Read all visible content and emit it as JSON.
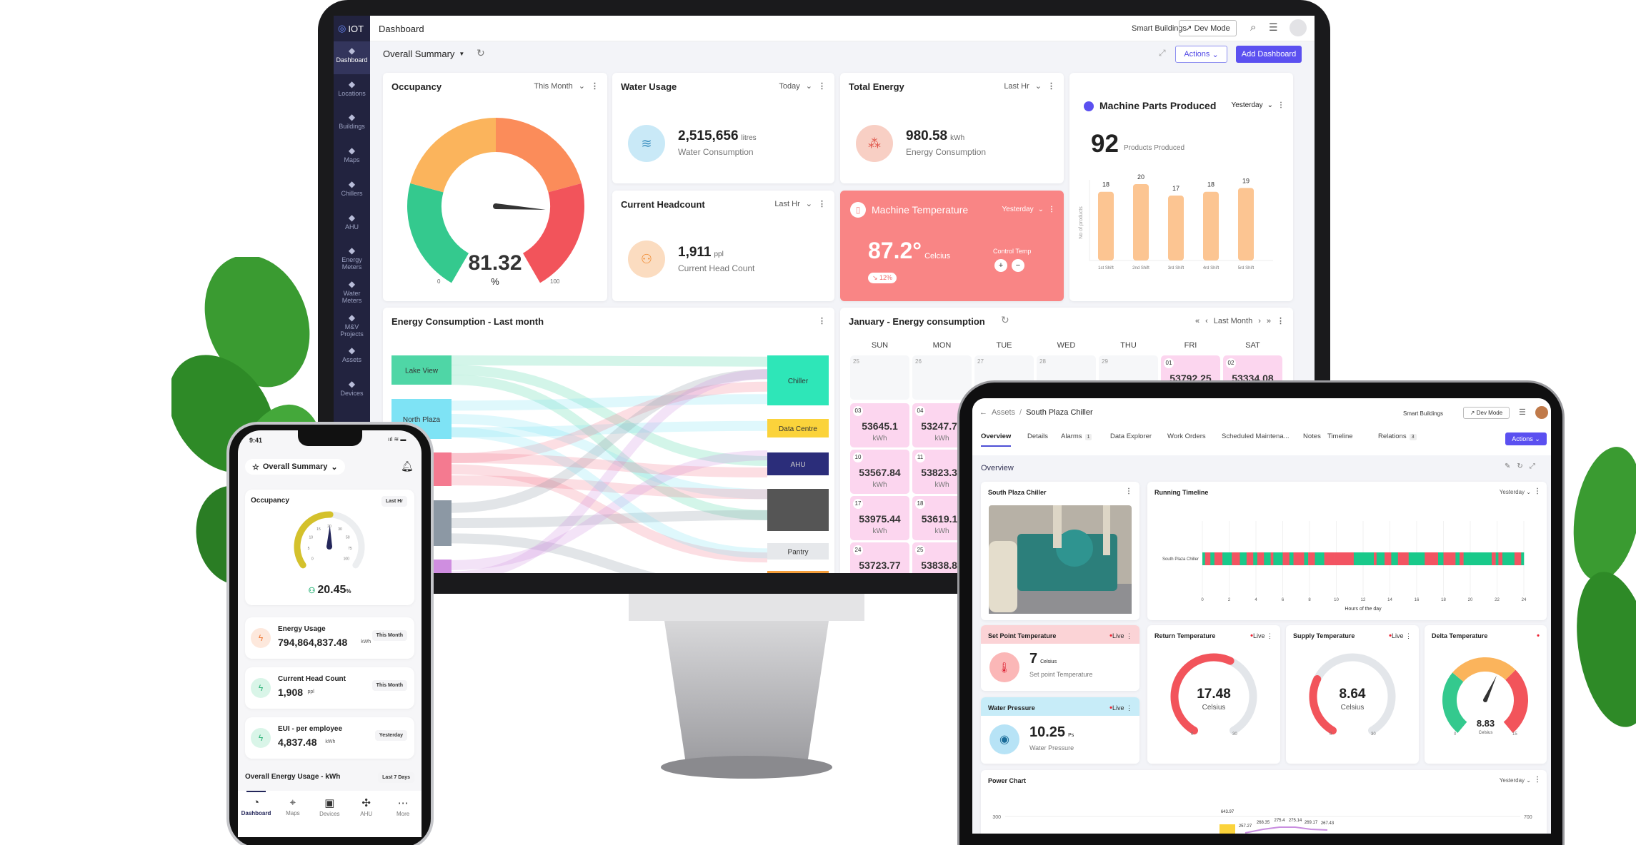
{
  "colors": {
    "accent": "#4f46e5",
    "sidebar": "#22233f",
    "green": "#34c98e",
    "red": "#f2545b",
    "orange": "#fb8c5a",
    "yellow": "#fbb45c",
    "pink": "#fcd6ef",
    "salmon": "#f98585"
  },
  "desktop": {
    "logo": "IOT",
    "header": {
      "title": "Dashboard",
      "org": "Smart Buildings",
      "dev_mode": "Dev Mode"
    },
    "toolbar": {
      "summary": "Overall Summary",
      "actions": "Actions",
      "add_dashboard": "Add Dashboard"
    },
    "sidebar": [
      {
        "label": "Dashboard",
        "icon": "dashboard-icon",
        "active": true
      },
      {
        "label": "Locations",
        "icon": "location-icon"
      },
      {
        "label": "Buildings",
        "icon": "building-icon"
      },
      {
        "label": "Maps",
        "icon": "map-pin-icon"
      },
      {
        "label": "Chillers",
        "icon": "chiller-icon"
      },
      {
        "label": "AHU",
        "icon": "ahu-icon"
      },
      {
        "label": "Energy Meters",
        "icon": "energy-meter-icon"
      },
      {
        "label": "Water Meters",
        "icon": "water-meter-icon"
      },
      {
        "label": "M&V Projects",
        "icon": "project-icon"
      },
      {
        "label": "Assets",
        "icon": "asset-icon"
      },
      {
        "label": "Devices",
        "icon": "device-icon"
      }
    ],
    "occupancy": {
      "title": "Occupancy",
      "period": "This Month",
      "value": 81.32,
      "value_text": "81.32",
      "unit": "%",
      "min": "0",
      "max": "100"
    },
    "water": {
      "title": "Water Usage",
      "period": "Today",
      "value": "2,515,656",
      "unit": "litres",
      "label": "Water Consumption"
    },
    "energy": {
      "title": "Total Energy",
      "period": "Last Hr",
      "value": "980.58",
      "unit": "kWh",
      "label": "Energy Consumption"
    },
    "headcount": {
      "title": "Current Headcount",
      "period": "Last Hr",
      "value": "1,911",
      "unit": "ppl",
      "label": "Current Head Count"
    },
    "machine_temp": {
      "title": "Machine Temperature",
      "period": "Yesterday",
      "value": "87.2°",
      "unit": "Celcius",
      "control": "Control Temp",
      "plus": "+",
      "minus": "−",
      "badge": "↘ 12%"
    },
    "parts": {
      "title": "Machine Parts Produced",
      "period": "Yesterday",
      "value": "92",
      "label": "Products Produced"
    },
    "sankey": {
      "title": "Energy Consumption - Last month",
      "sources": [
        {
          "label": "Lake View",
          "color": "#4fd6a6"
        },
        {
          "label": "North Plaza",
          "color": "#7ee3f5"
        },
        {
          "label": "",
          "color": "#f47a90"
        },
        {
          "label": "",
          "color": "#8c98a4"
        },
        {
          "label": "",
          "color": "#cf8ee0"
        }
      ],
      "targets": [
        {
          "label": "Chiller",
          "color": "#2ee6b8"
        },
        {
          "label": "Data Centre",
          "color": "#fbd33b"
        },
        {
          "label": "AHU",
          "color": "#2b2d7a"
        },
        {
          "label": "",
          "color": "#555"
        },
        {
          "label": "Pantry",
          "color": "#e6e8eb"
        },
        {
          "label": "",
          "color": "#f59e3b"
        }
      ]
    },
    "calendar": {
      "title": "January - Energy consumption",
      "nav": "Last Month",
      "days": [
        "SUN",
        "MON",
        "TUE",
        "WED",
        "THU",
        "FRI",
        "SAT"
      ],
      "cells": [
        {
          "row": 0,
          "col": 0,
          "date": "25"
        },
        {
          "row": 0,
          "col": 1,
          "date": "26"
        },
        {
          "row": 0,
          "col": 2,
          "date": "27"
        },
        {
          "row": 0,
          "col": 3,
          "date": "28"
        },
        {
          "row": 0,
          "col": 4,
          "date": "29"
        },
        {
          "row": 0,
          "col": 5,
          "date": "01",
          "value": "53792.25",
          "unit": "kWh"
        },
        {
          "row": 0,
          "col": 6,
          "date": "02",
          "value": "53334.08",
          "unit": "kWh"
        },
        {
          "row": 1,
          "col": 0,
          "date": "03",
          "value": "53645.1",
          "unit": "kWh"
        },
        {
          "row": 1,
          "col": 1,
          "date": "04",
          "value": "53247.76",
          "unit": "kWh"
        },
        {
          "row": 2,
          "col": 0,
          "date": "10",
          "value": "53567.84",
          "unit": "kWh"
        },
        {
          "row": 2,
          "col": 1,
          "date": "11",
          "value": "53823.33",
          "unit": "kWh"
        },
        {
          "row": 3,
          "col": 0,
          "date": "17",
          "value": "53975.44",
          "unit": "kWh"
        },
        {
          "row": 3,
          "col": 1,
          "date": "18",
          "value": "53619.11",
          "unit": "kWh"
        },
        {
          "row": 4,
          "col": 0,
          "date": "24",
          "value": "53723.77",
          "unit": "kWh"
        },
        {
          "row": 4,
          "col": 1,
          "date": "25",
          "value": "53838.82",
          "unit": "kWh"
        }
      ]
    }
  },
  "chart_data": [
    {
      "type": "bar",
      "title": "Machine Parts Produced",
      "ylabel": "No of products",
      "categories": [
        "1st Shift",
        "2nd Shift",
        "3rd Shift",
        "4rd Shift",
        "5rd Shift"
      ],
      "values": [
        18,
        20,
        17,
        18,
        19
      ],
      "ylim": [
        0,
        20
      ],
      "grid": false
    },
    {
      "type": "timeline",
      "title": "Running Timeline",
      "period": "Yesterday",
      "row_label": "South Plaza Chiller",
      "xlabel": "Hours of the day",
      "xticks": [
        "0",
        "2",
        "4",
        "6",
        "8",
        "10",
        "12",
        "14",
        "16",
        "18",
        "20",
        "22",
        "24"
      ],
      "xlim": [
        0,
        24
      ],
      "segments": [
        [
          0,
          0.2,
          "on"
        ],
        [
          0.2,
          0.6,
          "off"
        ],
        [
          0.6,
          0.9,
          "on"
        ],
        [
          0.9,
          1.5,
          "off"
        ],
        [
          1.5,
          2.2,
          "on"
        ],
        [
          2.2,
          2.8,
          "off"
        ],
        [
          2.8,
          3.3,
          "on"
        ],
        [
          3.3,
          3.8,
          "off"
        ],
        [
          3.8,
          4.1,
          "on"
        ],
        [
          4.1,
          4.6,
          "off"
        ],
        [
          4.6,
          5.1,
          "on"
        ],
        [
          5.1,
          5.3,
          "off"
        ],
        [
          5.3,
          6.0,
          "on"
        ],
        [
          6.0,
          6.5,
          "off"
        ],
        [
          6.5,
          6.8,
          "on"
        ],
        [
          6.8,
          7.6,
          "off"
        ],
        [
          7.6,
          7.9,
          "on"
        ],
        [
          7.9,
          8.4,
          "off"
        ],
        [
          8.4,
          9.1,
          "on"
        ],
        [
          9.1,
          9.9,
          "off"
        ],
        [
          9.9,
          11.3,
          "off"
        ],
        [
          11.3,
          12.8,
          "on"
        ],
        [
          12.8,
          13.0,
          "off"
        ],
        [
          13.0,
          13.6,
          "on"
        ],
        [
          13.6,
          14.1,
          "off"
        ],
        [
          14.1,
          14.6,
          "on"
        ],
        [
          14.6,
          15.4,
          "off"
        ],
        [
          15.4,
          16.6,
          "on"
        ],
        [
          16.6,
          17.6,
          "off"
        ],
        [
          17.6,
          18.0,
          "on"
        ],
        [
          18.0,
          18.9,
          "off"
        ],
        [
          18.9,
          19.2,
          "on"
        ],
        [
          19.2,
          19.5,
          "off"
        ],
        [
          19.5,
          20.0,
          "on"
        ],
        [
          20.0,
          21.6,
          "on"
        ],
        [
          21.6,
          21.9,
          "off"
        ],
        [
          21.9,
          22.1,
          "on"
        ],
        [
          22.1,
          22.4,
          "off"
        ],
        [
          22.4,
          23.3,
          "on"
        ],
        [
          23.3,
          23.8,
          "off"
        ],
        [
          23.8,
          24,
          "on"
        ]
      ],
      "colors": {
        "on": "#19c98a",
        "off": "#f25462"
      }
    },
    {
      "type": "line",
      "title": "Power Chart",
      "period": "Yesterday",
      "y_left_max_label": "300",
      "y_right_max_label": "700",
      "labels": [
        "643.97",
        "257.27",
        "268.35",
        "275.4",
        "275.14",
        "269.17",
        "267.43"
      ]
    }
  ],
  "tablet": {
    "breadcrumb": {
      "parent": "Assets",
      "separator": "/",
      "current": "South Plaza Chiller"
    },
    "org": "Smart Buildings",
    "dev_mode": "Dev Mode",
    "actions": "Actions",
    "tabs": [
      {
        "label": "Overview",
        "active": true
      },
      {
        "label": "Details"
      },
      {
        "label": "Alarms",
        "badge": "1"
      },
      {
        "label": "Data Explorer"
      },
      {
        "label": "Work Orders"
      },
      {
        "label": "Scheduled Maintena..."
      },
      {
        "label": "Notes"
      },
      {
        "label": "Timeline"
      },
      {
        "label": "Relations",
        "badge": "3"
      }
    ],
    "section": "Overview",
    "asset_card": {
      "title": "South Plaza Chiller"
    },
    "live": "Live",
    "setpoint": {
      "title": "Set Point Temperature",
      "value": "7",
      "unit": "Celsius",
      "label": "Set point Temperature"
    },
    "pressure": {
      "title": "Water Pressure",
      "value": "10.25",
      "unit": "Ps",
      "label": "Water Pressure"
    },
    "return_temp": {
      "title": "Return Temperature",
      "value": 17.48,
      "value_text": "17.48",
      "unit": "Celsius",
      "min": "0",
      "max": "30",
      "max_value": 30
    },
    "supply_temp": {
      "title": "Supply Temperature",
      "value": 8.64,
      "value_text": "8.64",
      "unit": "Celsius",
      "min": "0",
      "max": "30",
      "max_value": 30
    },
    "delta_temp": {
      "title": "Delta Temperature",
      "value": 8.83,
      "value_text": "8.83",
      "unit": "Celsius",
      "min": "0",
      "max": "15",
      "max_value": 15
    }
  },
  "phone": {
    "time": "9:41",
    "summary": "Overall Summary",
    "occupancy": {
      "title": "Occupancy",
      "period": "Last Hr",
      "value": 20.45,
      "value_text": "20.45",
      "unit": "%",
      "ticks": [
        "0",
        "5",
        "10",
        "15",
        "20",
        "30",
        "50",
        "75",
        "100"
      ]
    },
    "cards": [
      {
        "title": "Energy Usage",
        "value": "794,864,837.48",
        "unit": "kWh",
        "period": "This Month",
        "icon": "lightning-icon",
        "bg": "#fde8dc",
        "fg": "#f07a36"
      },
      {
        "title": "Current Head Count",
        "value": "1,908",
        "unit": "ppl",
        "period": "This Month",
        "icon": "people-icon",
        "bg": "#d9f5e8",
        "fg": "#2fb57a"
      },
      {
        "title": "EUI - per employee",
        "value": "4,837.48",
        "unit": "kWh",
        "period": "Yesterday",
        "icon": "lightning-icon",
        "bg": "#d9f5e8",
        "fg": "#2fb57a"
      }
    ],
    "overall": {
      "title": "Overall Energy Usage - kWh",
      "period": "Last 7 Days"
    },
    "nav": [
      {
        "label": "Dashboard",
        "icon": "dashboard-icon",
        "active": true
      },
      {
        "label": "Maps",
        "icon": "map-pin-icon"
      },
      {
        "label": "Devices",
        "icon": "device-icon"
      },
      {
        "label": "AHU",
        "icon": "fan-icon"
      },
      {
        "label": "More",
        "icon": "more-icon"
      }
    ]
  }
}
